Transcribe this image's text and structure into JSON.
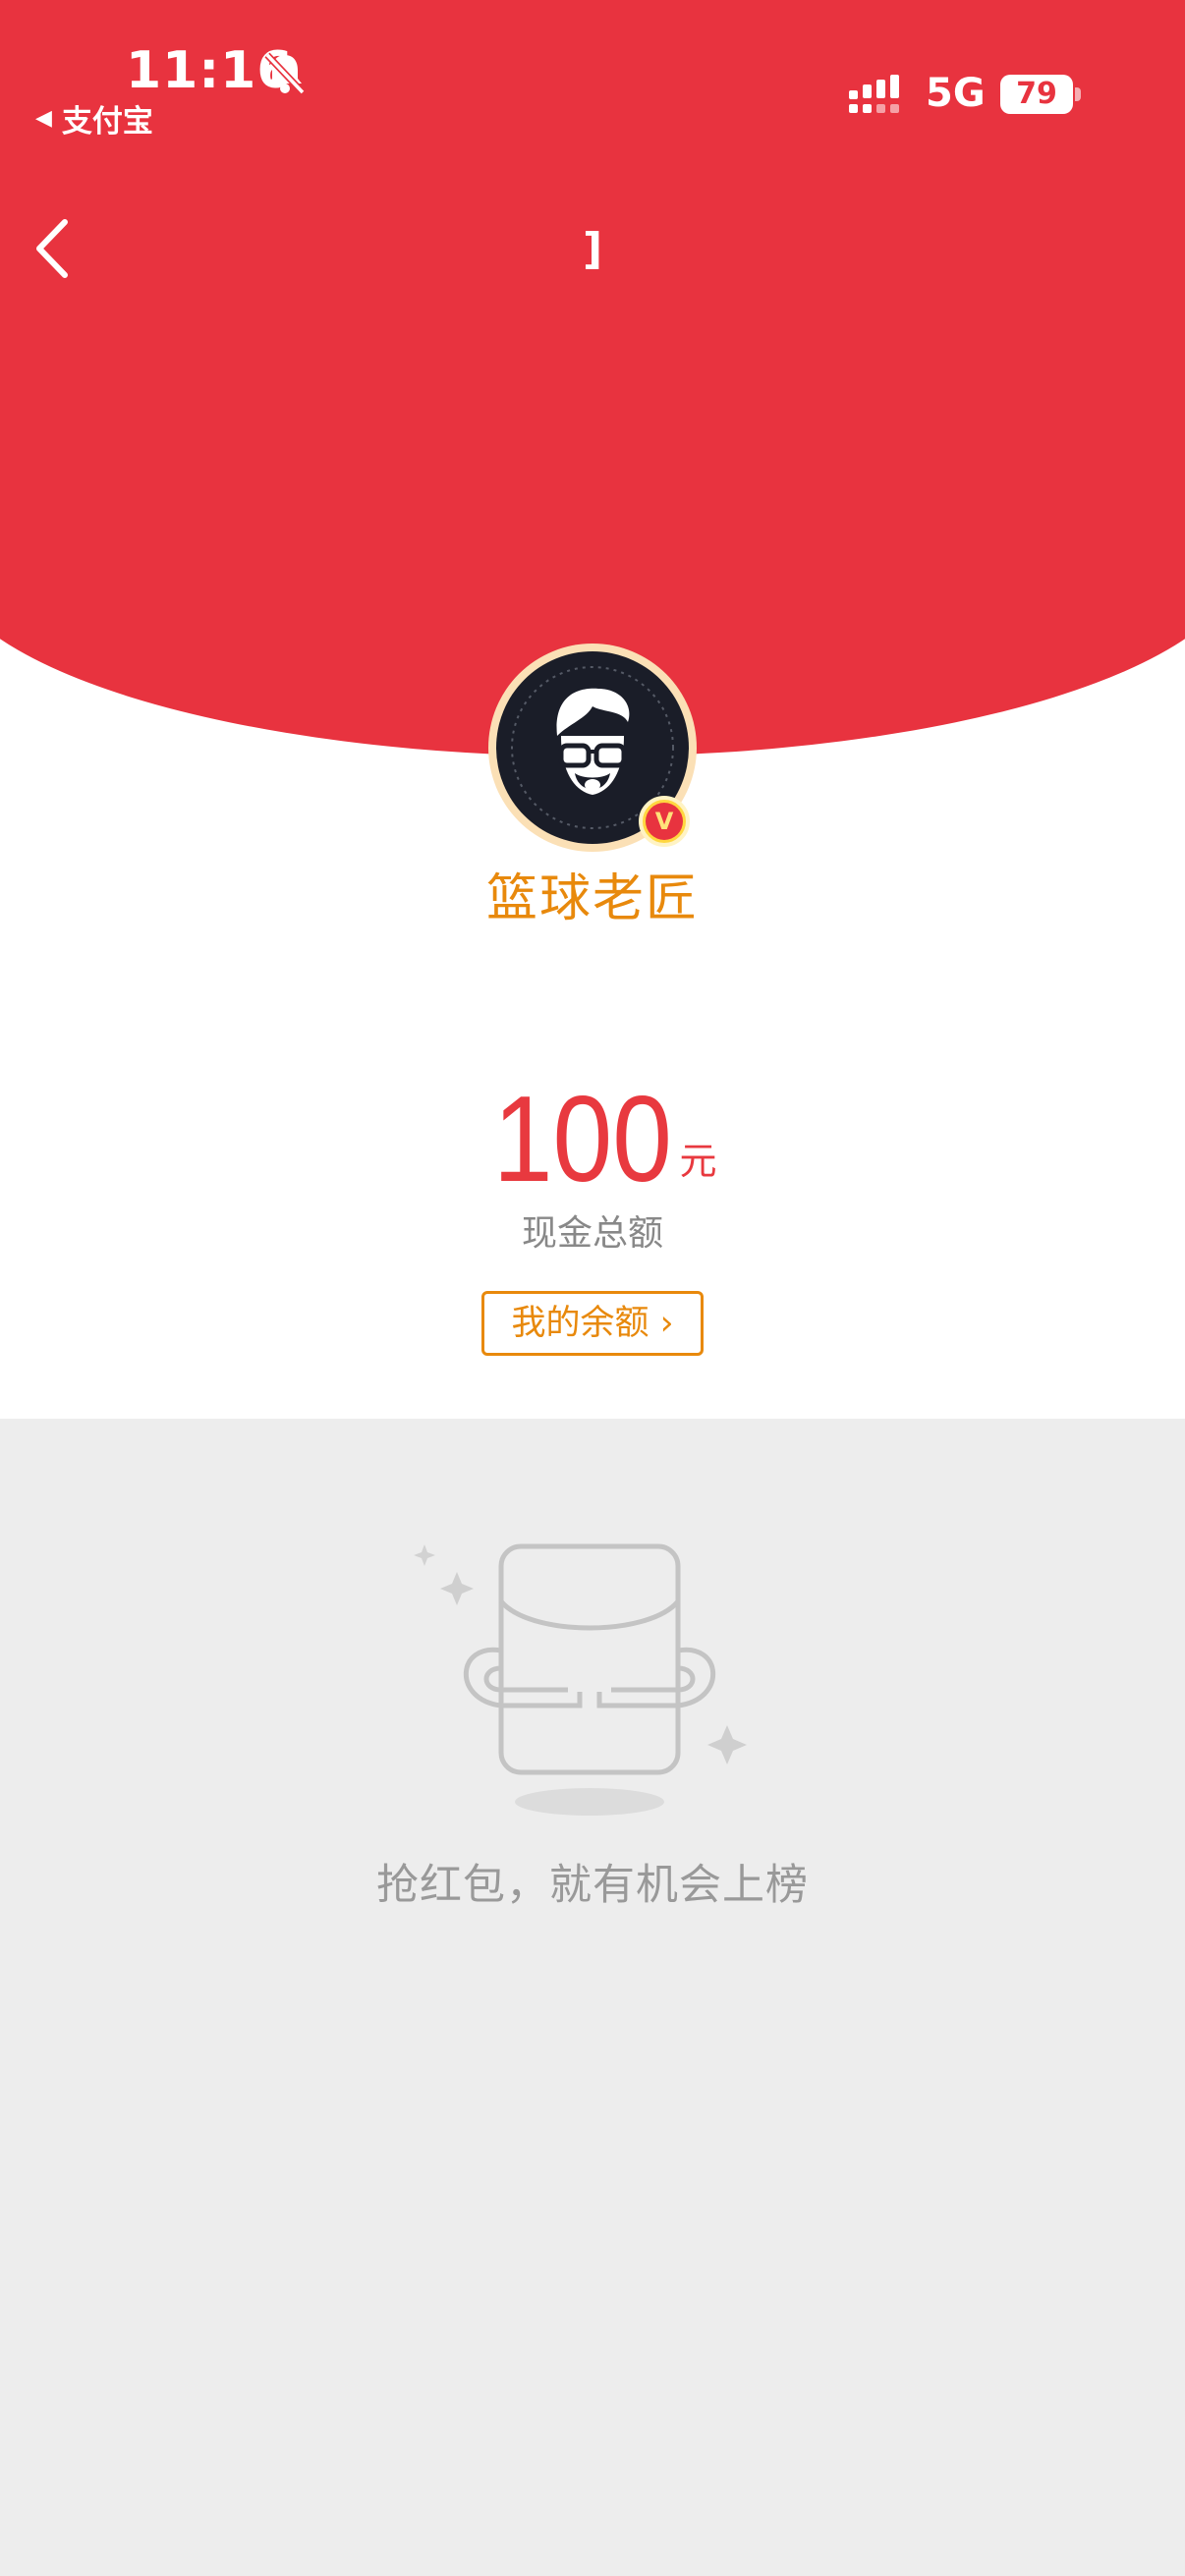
{
  "status_bar": {
    "time": "11:16",
    "back_app": "支付宝",
    "network": "5G",
    "battery": "79"
  },
  "nav": {
    "title": "]"
  },
  "sender": {
    "name": "篮球老匠",
    "badge": "V"
  },
  "amount": {
    "value": "100",
    "unit": "元",
    "label": "现金总额"
  },
  "balance_button": {
    "label": "我的余额 ›"
  },
  "empty_state": {
    "text": "抢红包，就有机会上榜"
  },
  "colors": {
    "brand_red": "#e8333f",
    "accent_orange": "#e8890c",
    "cream": "#fbe0b6"
  },
  "icons": [
    "bell-slash-icon",
    "signal-icon",
    "battery-icon",
    "back-chevron-icon",
    "empty-red-packet-icon"
  ]
}
